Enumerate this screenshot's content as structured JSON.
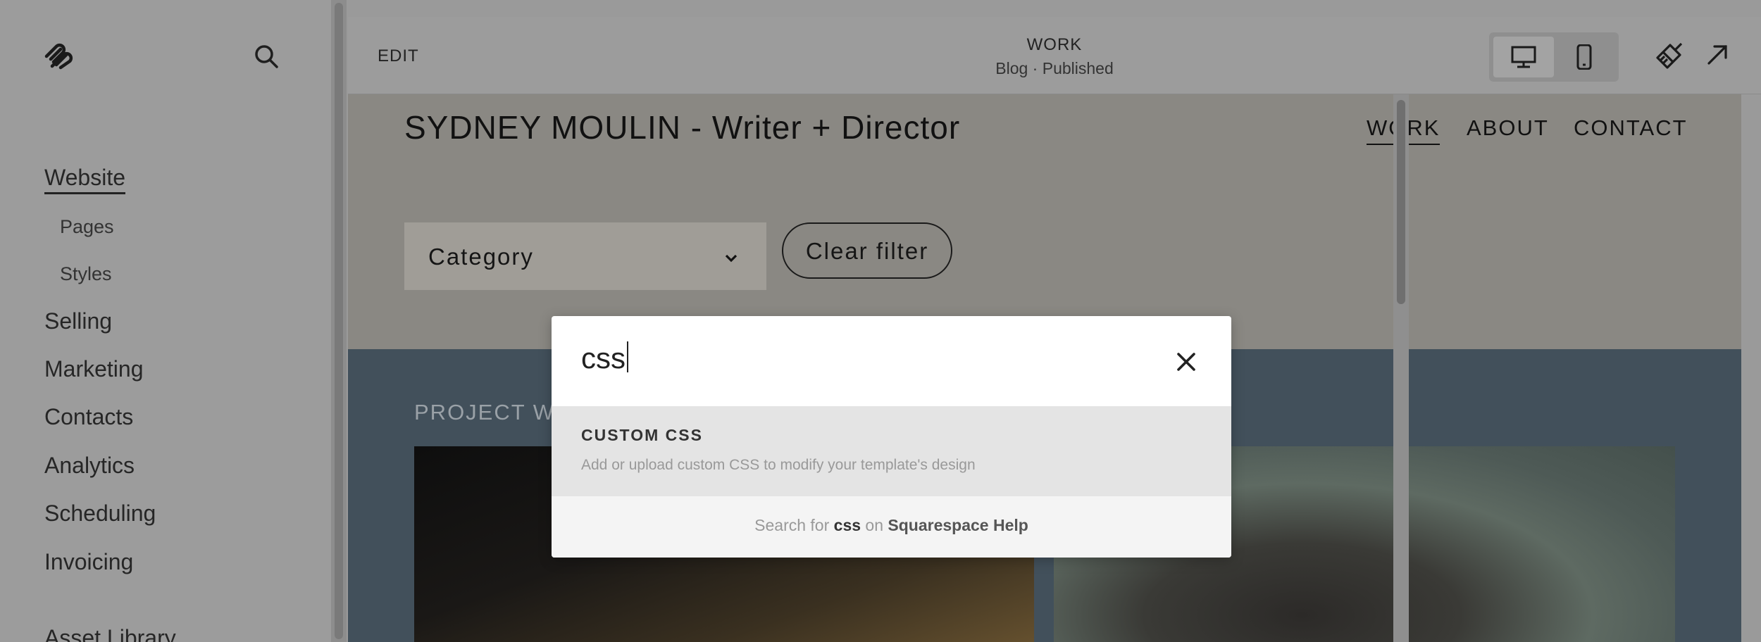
{
  "sidebar": {
    "logo_icon": "squarespace-logo-icon",
    "search_icon": "search-icon",
    "items": [
      {
        "label": "Website",
        "active": true
      },
      {
        "label": "Pages",
        "sub": true
      },
      {
        "label": "Styles",
        "sub": true
      },
      {
        "label": "Selling"
      },
      {
        "label": "Marketing"
      },
      {
        "label": "Contacts"
      },
      {
        "label": "Analytics"
      },
      {
        "label": "Scheduling"
      },
      {
        "label": "Invoicing"
      },
      {
        "label": "Asset Library"
      }
    ]
  },
  "topbar": {
    "edit_label": "EDIT",
    "page_title": "WORK",
    "page_subtitle": "Blog · Published",
    "device_icons": [
      "desktop-icon",
      "mobile-icon"
    ],
    "style_icon": "brush-icon",
    "exit_icon": "exit-arrow-icon"
  },
  "site": {
    "title": "SYDNEY MOULIN - Writer + Director",
    "nav": [
      "WORK",
      "ABOUT",
      "CONTACT"
    ],
    "category_label": "Category",
    "clear_filter_label": "Clear filter",
    "project_title": "PROJECT WIT"
  },
  "search_modal": {
    "query": "css",
    "result_title": "CUSTOM CSS",
    "result_desc": "Add or upload custom CSS to modify your template's design",
    "footer_prefix": "Search for",
    "footer_term": "css",
    "footer_mid": "on",
    "footer_link": "Squarespace Help"
  },
  "colors": {
    "overlay_gray": "#9c9c9c",
    "band_blue": "#42505b",
    "result_highlight": "#e4e4e4"
  }
}
